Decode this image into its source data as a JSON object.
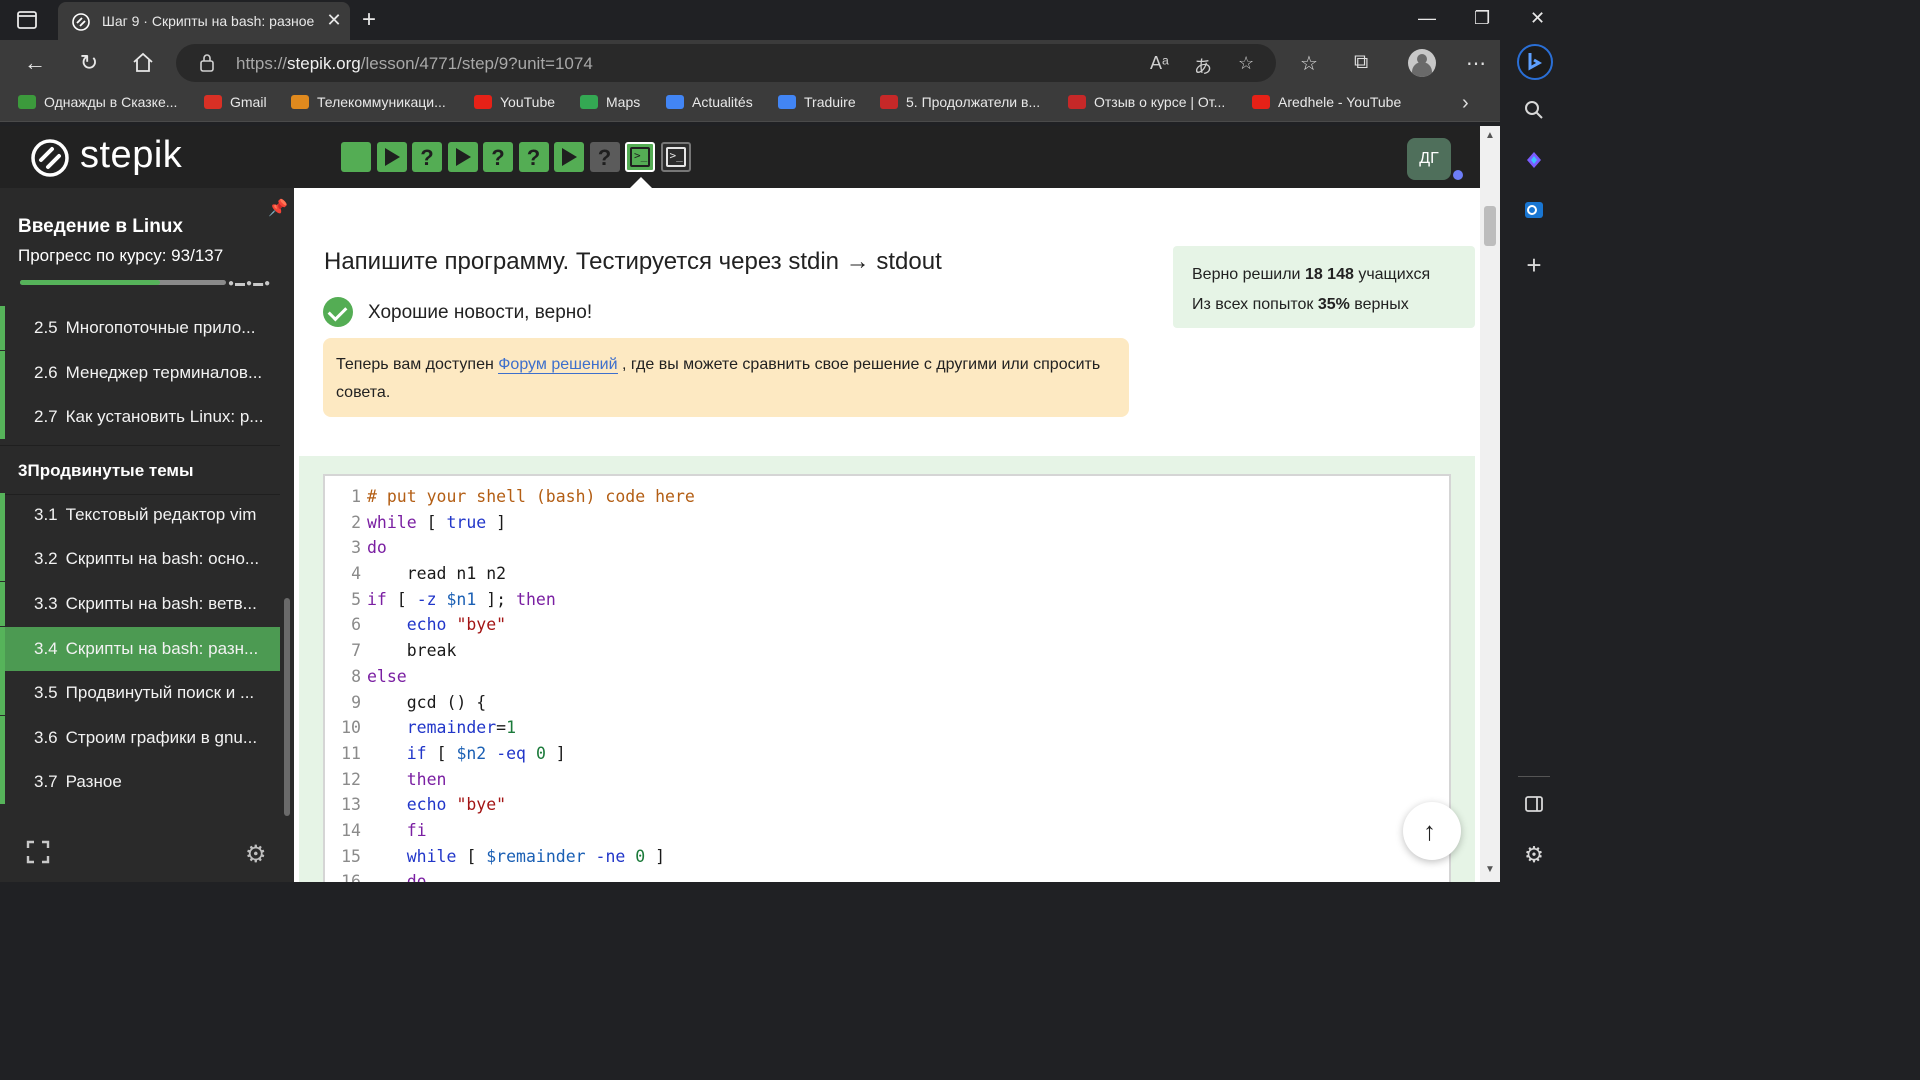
{
  "browser": {
    "tab_title": "Шаг 9 · Скрипты на bash: разное",
    "url_prefix": "https://",
    "url_domain": "stepik.org",
    "url_path": "/lesson/4771/step/9?unit=1074",
    "bookmarks": [
      {
        "label": "Однажды в Сказке...",
        "icon": "hd-icon",
        "color": "#3c9a3c"
      },
      {
        "label": "Gmail",
        "icon": "gmail-icon",
        "color": "#d93025"
      },
      {
        "label": "Телекоммуникаци...",
        "icon": "telecom-icon",
        "color": "#e08a1e"
      },
      {
        "label": "YouTube",
        "icon": "youtube-icon",
        "color": "#e62117"
      },
      {
        "label": "Maps",
        "icon": "maps-icon",
        "color": "#34a853"
      },
      {
        "label": "Actualités",
        "icon": "news-icon",
        "color": "#4285f4"
      },
      {
        "label": "Traduire",
        "icon": "translate-icon",
        "color": "#4285f4"
      },
      {
        "label": "5. Продолжатели в...",
        "icon": "bookmark-video-icon",
        "color": "#c62828"
      },
      {
        "label": "Отзыв о курсе | От...",
        "icon": "bookmark-video-icon",
        "color": "#c62828"
      },
      {
        "label": "Aredhele - YouTube",
        "icon": "youtube-icon",
        "color": "#e62117"
      }
    ]
  },
  "stepik": {
    "logo_text": "stepik",
    "avatar_initials": "ДГ",
    "steps": [
      {
        "kind": "solved",
        "icon": "text-step-icon"
      },
      {
        "kind": "solved",
        "icon": "play-icon"
      },
      {
        "kind": "solved",
        "icon": "question-icon"
      },
      {
        "kind": "solved",
        "icon": "play-icon"
      },
      {
        "kind": "solved",
        "icon": "question-icon"
      },
      {
        "kind": "solved",
        "icon": "question-icon"
      },
      {
        "kind": "solved",
        "icon": "play-icon"
      },
      {
        "kind": "gray",
        "icon": "question-icon"
      },
      {
        "kind": "term-solved",
        "icon": "terminal-icon"
      },
      {
        "kind": "term",
        "icon": "terminal-icon"
      }
    ]
  },
  "sidebar": {
    "course_title": "Введение в Linux",
    "progress_label": "Прогресс по курсу:  93/137",
    "progress_fraction": 0.679,
    "items": [
      {
        "num": "2.5",
        "label": "Многопоточные прило...",
        "type": "lesson"
      },
      {
        "num": "2.6",
        "label": "Менеджер терминалов...",
        "type": "lesson"
      },
      {
        "num": "2.7",
        "label": "Как установить Linux: р...",
        "type": "lesson"
      },
      {
        "num": "3",
        "label": "Продвинутые темы",
        "type": "section"
      },
      {
        "num": "3.1",
        "label": "Текстовый редактор vim",
        "type": "lesson"
      },
      {
        "num": "3.2",
        "label": "Скрипты на bash: осно...",
        "type": "lesson"
      },
      {
        "num": "3.3",
        "label": "Скрипты на bash: ветв...",
        "type": "lesson"
      },
      {
        "num": "3.4",
        "label": "Скрипты на bash: разн...",
        "type": "active"
      },
      {
        "num": "3.5",
        "label": "Продвинутый поиск и ...",
        "type": "lesson"
      },
      {
        "num": "3.6",
        "label": "Строим графики в gnu...",
        "type": "lesson"
      },
      {
        "num": "3.7",
        "label": "Разное",
        "type": "lesson"
      }
    ]
  },
  "main": {
    "task_title": "Напишите программу. Тестируется через stdin → stdout",
    "ok_text": "Хорошие новости, верно!",
    "notice_before": "Теперь вам доступен ",
    "notice_link": "Форум решений",
    "notice_after": " , где вы можете сравнить свое решение с другими или спросить совета.",
    "stats_line1_prefix": "Верно решили ",
    "stats_line1_value": "18 148",
    "stats_line1_suffix": " учащихся",
    "stats_line2_prefix": "Из всех попыток ",
    "stats_line2_value": "35%",
    "stats_line2_suffix": " верных"
  },
  "code_lines": [
    [
      {
        "t": "# put your shell (bash) code here",
        "c": "comment"
      }
    ],
    [
      {
        "t": "while",
        "c": "kw"
      },
      {
        "t": " [ ",
        "c": "plain"
      },
      {
        "t": "true",
        "c": "builtin"
      },
      {
        "t": " ]",
        "c": "plain"
      }
    ],
    [
      {
        "t": "do",
        "c": "kw"
      }
    ],
    [
      {
        "t": "    read n1 n2",
        "c": "plain"
      }
    ],
    [
      {
        "t": "if",
        "c": "kw"
      },
      {
        "t": " [ ",
        "c": "plain"
      },
      {
        "t": "-z",
        "c": "builtin"
      },
      {
        "t": " ",
        "c": "plain"
      },
      {
        "t": "$n1",
        "c": "var"
      },
      {
        "t": " ]; ",
        "c": "plain"
      },
      {
        "t": "then",
        "c": "kw"
      }
    ],
    [
      {
        "t": "    ",
        "c": "plain"
      },
      {
        "t": "echo",
        "c": "builtin"
      },
      {
        "t": " ",
        "c": "plain"
      },
      {
        "t": "\"bye\"",
        "c": "str"
      }
    ],
    [
      {
        "t": "    break",
        "c": "plain"
      }
    ],
    [
      {
        "t": "else",
        "c": "kw"
      }
    ],
    [
      {
        "t": "    gcd () {",
        "c": "plain"
      }
    ],
    [
      {
        "t": "    ",
        "c": "plain"
      },
      {
        "t": "remainder",
        "c": "builtin"
      },
      {
        "t": "=",
        "c": "plain"
      },
      {
        "t": "1",
        "c": "num"
      }
    ],
    [
      {
        "t": "    ",
        "c": "plain"
      },
      {
        "t": "if",
        "c": "builtin"
      },
      {
        "t": " [ ",
        "c": "plain"
      },
      {
        "t": "$n2",
        "c": "var"
      },
      {
        "t": " ",
        "c": "plain"
      },
      {
        "t": "-eq",
        "c": "builtin"
      },
      {
        "t": " ",
        "c": "plain"
      },
      {
        "t": "0",
        "c": "num"
      },
      {
        "t": " ]",
        "c": "plain"
      }
    ],
    [
      {
        "t": "    ",
        "c": "plain"
      },
      {
        "t": "then",
        "c": "kw"
      }
    ],
    [
      {
        "t": "    ",
        "c": "plain"
      },
      {
        "t": "echo",
        "c": "builtin"
      },
      {
        "t": " ",
        "c": "plain"
      },
      {
        "t": "\"bye\"",
        "c": "str"
      }
    ],
    [
      {
        "t": "    ",
        "c": "plain"
      },
      {
        "t": "fi",
        "c": "kw"
      }
    ],
    [
      {
        "t": "    ",
        "c": "plain"
      },
      {
        "t": "while",
        "c": "builtin"
      },
      {
        "t": " [ ",
        "c": "plain"
      },
      {
        "t": "$remainder",
        "c": "var"
      },
      {
        "t": " ",
        "c": "plain"
      },
      {
        "t": "-ne",
        "c": "builtin"
      },
      {
        "t": " ",
        "c": "plain"
      },
      {
        "t": "0",
        "c": "num"
      },
      {
        "t": " ]",
        "c": "plain"
      }
    ],
    [
      {
        "t": "    ",
        "c": "plain"
      },
      {
        "t": "do",
        "c": "kw"
      }
    ]
  ]
}
